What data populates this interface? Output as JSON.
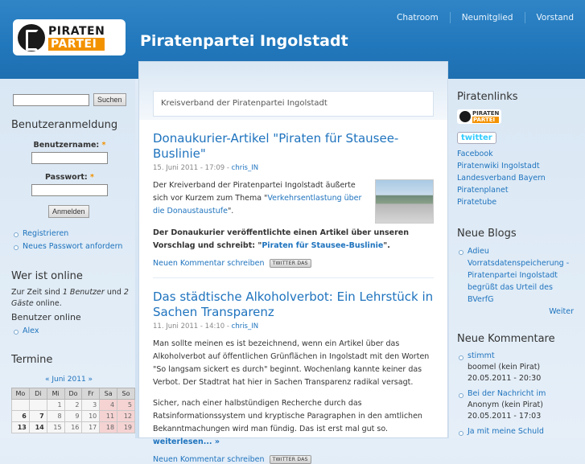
{
  "header": {
    "nav": [
      "Chatroom",
      "Neumitglied",
      "Vorstand"
    ],
    "logo_line1": "PIRATEN",
    "logo_line2": "PARTEI",
    "site_title": "Piratenpartei Ingolstadt"
  },
  "left": {
    "search_button": "Suchen",
    "login_title": "Benutzeranmeldung",
    "username_label": "Benutzername:",
    "password_label": "Passwort:",
    "required_mark": "*",
    "login_button": "Anmelden",
    "login_links": [
      "Registrieren",
      "Neues Passwort anfordern"
    ],
    "online_title": "Wer ist online",
    "online_text_1": "Zur Zeit sind ",
    "online_users": "1 Benutzer",
    "online_text_2": " und ",
    "online_guests": "2 Gäste",
    "online_text_3": " online.",
    "online_users_title": "Benutzer online",
    "online_user": "Alex",
    "termine_title": "Termine",
    "calendar_nav": "« Juni 2011 »",
    "calendar_days": [
      "Mo",
      "Di",
      "Mi",
      "Do",
      "Fr",
      "Sa",
      "So"
    ],
    "calendar_rows": [
      [
        "",
        "",
        "1",
        "2",
        "3",
        "4",
        "5"
      ],
      [
        "6",
        "7",
        "8",
        "9",
        "10",
        "11",
        "12"
      ],
      [
        "13",
        "14",
        "15",
        "16",
        "17",
        "18",
        "19"
      ]
    ]
  },
  "main": {
    "description": "Kreisverband der Piratenpartei Ingolstadt",
    "post1": {
      "title": "Donaukurier-Artikel \"Piraten für Stausee-Buslinie\"",
      "date": "15. Juni 2011 - 17:09 - ",
      "author": "chris_IN",
      "p1_text": "Der Kreiverband der Piratenpartei Ingolstadt äußerte sich vor Kurzem zum Thema \"",
      "p1_link": "Verkehrsentlastung über die Donaustaustufe",
      "p1_end": "\".",
      "p2_text": "Der Donaukurier veröffentlichte einen Artikel über unseren Vorschlag und schreibt: \"",
      "p2_link": "Piraten für Stausee-Buslinie",
      "p2_end": "\".",
      "comment_link": "Neuen Kommentar schreiben",
      "twitter_button": "TWITTER DAS"
    },
    "post2": {
      "title": "Das städtische Alkoholverbot: Ein Lehrstück in Sachen Transparenz",
      "date": "11. Juni 2011 - 14:10 - ",
      "author": "chris_IN",
      "p1": "Man sollte meinen es ist bezeichnend, wenn ein Artikel über das Alkoholverbot auf öffentlichen Grünflächen in Ingolstadt mit den Worten \"So langsam sickert es durch\" beginnt. Wochenlang kannte keiner das Verbot. Der Stadtrat hat hier in Sachen Transparenz radikal versagt.",
      "p2": "Sicher, nach einer halbstündigen Recherche durch das Ratsinformationssystem und kryptische Paragraphen in den amtlichen Bekanntmachungen wird man fündig. Das ist erst mal gut so.",
      "read_more": "weiterlesen... »",
      "comment_link": "Neuen Kommentar schreiben",
      "twitter_button": "TWITTER DAS"
    }
  },
  "right": {
    "links_title": "Piratenlinks",
    "twitter_logo": "twitter",
    "links": [
      "Facebook",
      "Piratenwiki Ingolstadt",
      "Landesverband Bayern",
      "Piratenplanet",
      "Piratetube"
    ],
    "blogs_title": "Neue Blogs",
    "blog_item": "Adieu Vorratsdatenspeicherung - Piratenpartei Ingolstadt begrüßt das Urteil des BVerfG",
    "more": "Weiter",
    "comments_title": "Neue Kommentare",
    "comments": [
      {
        "title": "stimmt",
        "author": "boomel (kein Pirat)",
        "date": "20.05.2011 - 20:30"
      },
      {
        "title": "Bei der Nachricht im",
        "author": "Anonym (kein Pirat)",
        "date": "20.05.2011 - 17:03"
      },
      {
        "title": "Ja mit meine Schuld",
        "author": "",
        "date": ""
      }
    ]
  },
  "colors": {
    "brand_blue": "#2177bb",
    "pirate_orange": "#f39200",
    "link": "#1e73be"
  }
}
